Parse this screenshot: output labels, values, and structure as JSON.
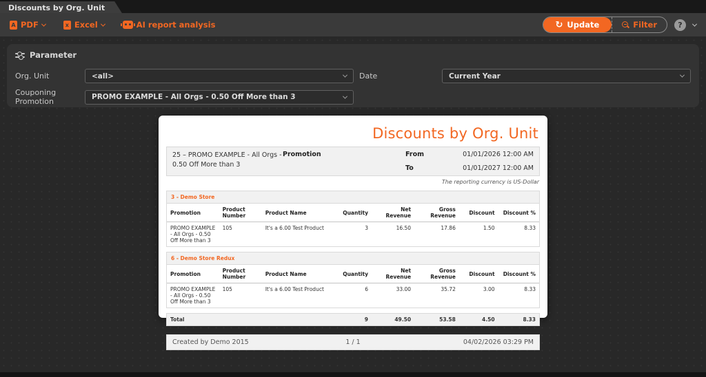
{
  "colors": {
    "accent": "#f26722",
    "card_bg": "#ffffff",
    "app_bg": "#282828"
  },
  "tab": {
    "title": "Discounts by Org. Unit"
  },
  "toolbar": {
    "pdf_label": "PDF",
    "excel_label": "Excel",
    "ai_label": "AI report analysis",
    "update_label": "Update",
    "filter_label": "Filter",
    "icons": {
      "pdf_letter": "A",
      "excel_letter": "x",
      "refresh": "↻",
      "help": "?"
    }
  },
  "parameters": {
    "title": "Parameter",
    "org_unit": {
      "label": "Org. Unit",
      "value": "<all>"
    },
    "date": {
      "label": "Date",
      "value": "Current Year"
    },
    "couponing": {
      "label": "Couponing Promotion",
      "value": "PROMO EXAMPLE - All Orgs - 0.50 Off More than 3"
    }
  },
  "report": {
    "title": "Discounts by Org. Unit",
    "info": {
      "promotion_label": "Promotion",
      "promotion_value": "25 – PROMO EXAMPLE - All Orgs - 0.50 Off More than 3",
      "from_label": "From",
      "from_value": "01/01/2026 12:00 AM",
      "to_label": "To",
      "to_value": "01/01/2027 12:00 AM"
    },
    "currency_note": "The reporting currency is US-Dollar",
    "columns": [
      "Promotion",
      "Product Number",
      "Product Name",
      "Quantity",
      "Net Revenue",
      "Gross Revenue",
      "Discount",
      "Discount %"
    ],
    "sections": [
      {
        "group": "3 - Demo Store",
        "rows": [
          {
            "promotion": "PROMO EXAMPLE - All Orgs - 0.50 Off More than 3",
            "product_number": "105",
            "product_name": "It's a 6.00 Test Product",
            "quantity": "3",
            "net_revenue": "16.50",
            "gross_revenue": "17.86",
            "discount": "1.50",
            "discount_pct": "8.33"
          }
        ]
      },
      {
        "group": "6 - Demo Store Redux",
        "rows": [
          {
            "promotion": "PROMO EXAMPLE - All Orgs - 0.50 Off More than 3",
            "product_number": "105",
            "product_name": "It's a 6.00 Test Product",
            "quantity": "6",
            "net_revenue": "33.00",
            "gross_revenue": "35.72",
            "discount": "3.00",
            "discount_pct": "8.33"
          }
        ]
      }
    ],
    "total": {
      "label": "Total",
      "quantity": "9",
      "net_revenue": "49.50",
      "gross_revenue": "53.58",
      "discount": "4.50",
      "discount_pct": "8.33"
    },
    "footer": {
      "created_by": "Created by Demo 2015",
      "page": "1 / 1",
      "timestamp": "04/02/2026 03:29 PM"
    }
  }
}
